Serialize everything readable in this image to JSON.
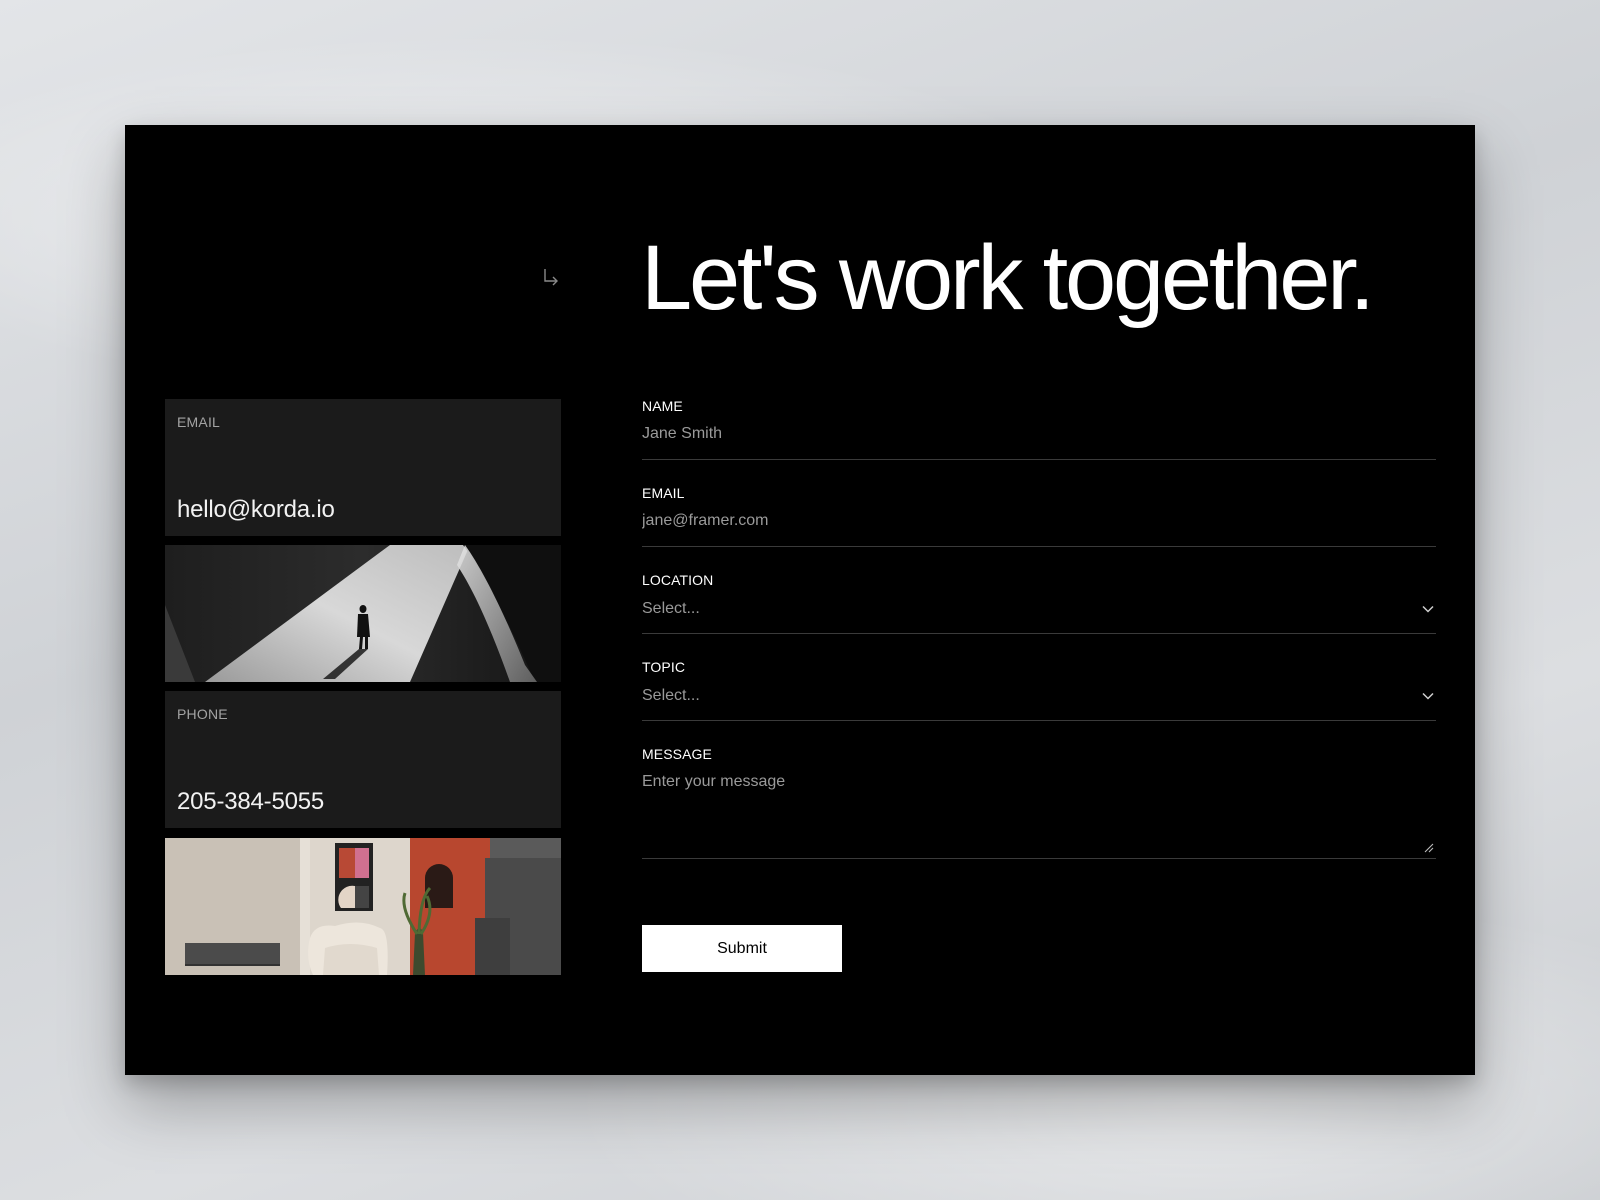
{
  "headline": "Let's work together.",
  "contact_cards": {
    "email": {
      "label": "EMAIL",
      "value": "hello@korda.io"
    },
    "phone": {
      "label": "PHONE",
      "value": "205-384-5055"
    }
  },
  "images": {
    "photo_1": "photo-person-on-stairs",
    "photo_2": "photo-interior-room"
  },
  "form": {
    "name": {
      "label": "NAME",
      "placeholder": "Jane Smith"
    },
    "email": {
      "label": "EMAIL",
      "placeholder": "jane@framer.com"
    },
    "location": {
      "label": "LOCATION",
      "value": "Select..."
    },
    "topic": {
      "label": "TOPIC",
      "value": "Select..."
    },
    "message": {
      "label": "MESSAGE",
      "placeholder": "Enter your message"
    },
    "submit_label": "Submit"
  },
  "icons": {
    "corner": "arrow-down-right-icon",
    "select": "chevron-down-icon",
    "resize": "resize-handle-icon"
  },
  "colors": {
    "frame_background": "#000000",
    "card_background": "#1b1b1b",
    "divider": "#3a3a3a",
    "button_background": "#ffffff"
  }
}
